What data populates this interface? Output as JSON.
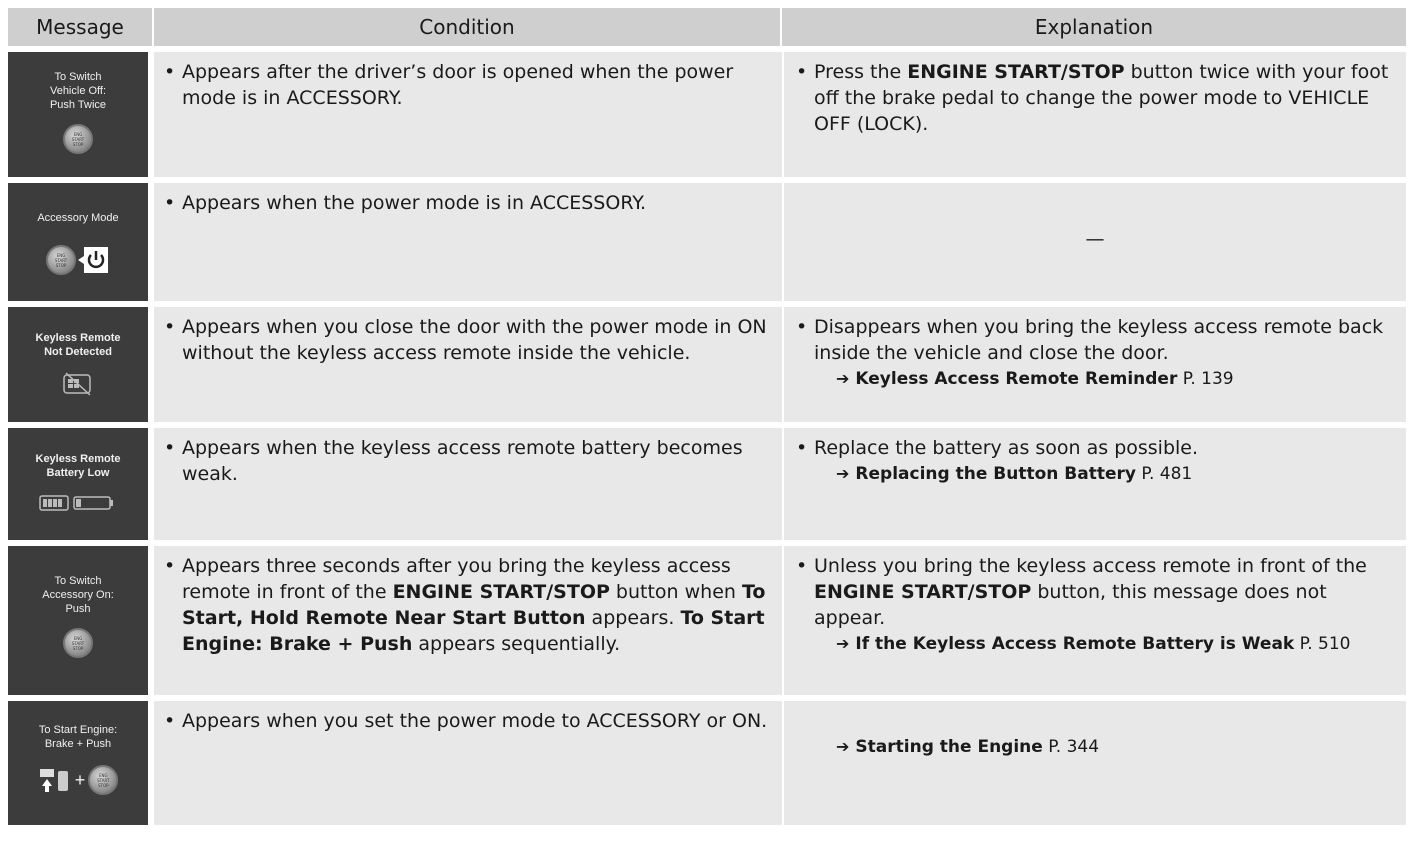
{
  "headers": {
    "message": "Message",
    "condition": "Condition",
    "explanation": "Explanation"
  },
  "rows": [
    {
      "screen_text": "To Switch\nVehicle Off:\nPush Twice",
      "condition": [
        "Appears after the driver’s door is opened when the power mode is in ACCESSORY."
      ],
      "explanation": [
        "Press the ",
        "ENGINE START/STOP",
        " button twice with your foot off the brake pedal to change the power mode to VEHICLE OFF (LOCK)."
      ]
    },
    {
      "screen_text": "Accessory Mode",
      "condition": [
        "Appears when the power mode is in ACCESSORY."
      ],
      "explanation_dash": "—"
    },
    {
      "screen_text": "Keyless Remote\nNot Detected",
      "condition": [
        "Appears when you close the door with the power mode in ON without the keyless access remote inside the vehicle."
      ],
      "explanation": [
        "Disappears when you bring the keyless access remote back inside the vehicle and close the door."
      ],
      "ref": {
        "title": "Keyless Access Remote Reminder",
        "page": "P. 139"
      }
    },
    {
      "screen_text": "Keyless Remote\nBattery Low",
      "condition": [
        "Appears when the keyless access remote battery becomes weak."
      ],
      "explanation": [
        "Replace the battery as soon as possible."
      ],
      "ref": {
        "title": "Replacing the Button Battery",
        "page": "P. 481"
      }
    },
    {
      "screen_text": "To Switch\nAccessory On:\nPush",
      "condition": [
        "Appears three seconds after you bring the keyless access remote in front of the ",
        "ENGINE START/STOP",
        " button when ",
        "To Start, Hold Remote Near Start Button",
        " appears. ",
        "To Start Engine: Brake + Push",
        " appears sequentially."
      ],
      "explanation": [
        "Unless you bring the keyless access remote in front of the ",
        "ENGINE START/STOP",
        " button, this message does not appear."
      ],
      "ref": {
        "title": "If the Keyless Access Remote Battery is Weak",
        "page": "P. 510"
      }
    },
    {
      "screen_text": "To Start Engine:\nBrake + Push",
      "condition": [
        "Appears when you set the power mode to ACCESSORY or ON."
      ],
      "ref": {
        "title": "Starting the Engine",
        "page": "P. 344"
      }
    }
  ],
  "icons": {
    "engine_button_text": "ENGINE START STOP",
    "ref_arrow": "➔",
    "plus": "+"
  }
}
